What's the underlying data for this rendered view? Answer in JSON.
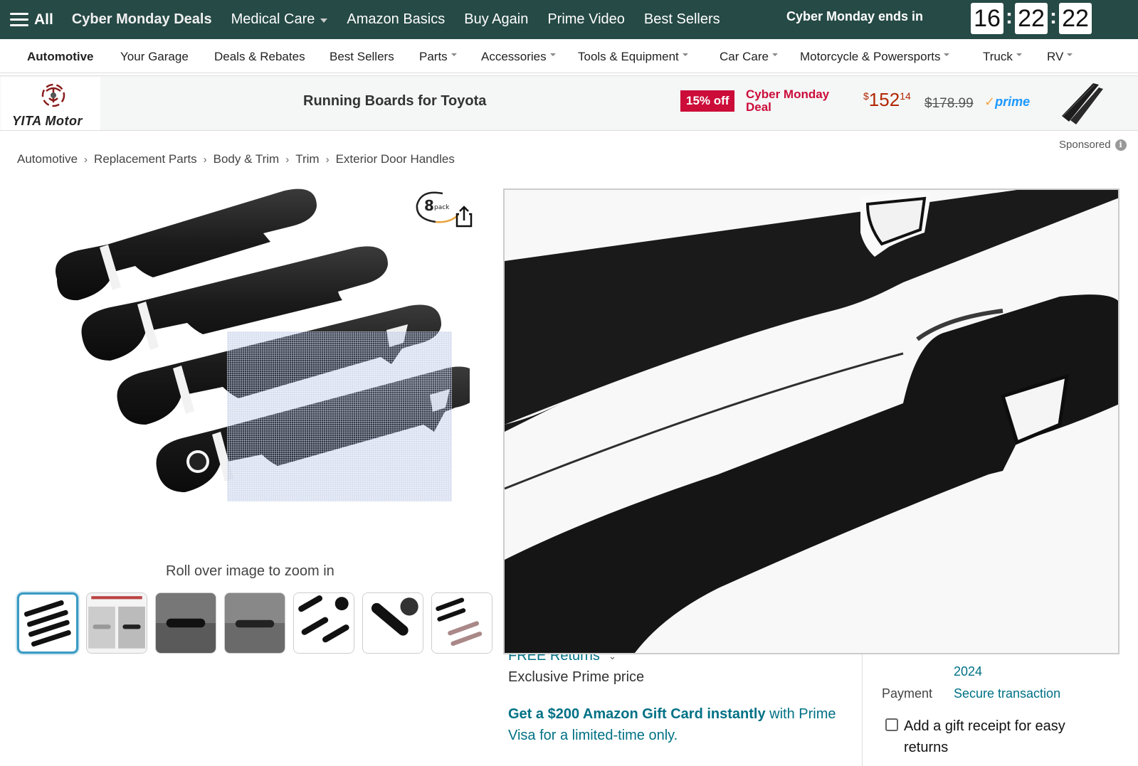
{
  "topnav": {
    "all_label": "All",
    "links": [
      {
        "label": "Cyber Monday Deals",
        "bold": true
      },
      {
        "label": "Medical Care",
        "dropdown": true
      },
      {
        "label": "Amazon Basics"
      },
      {
        "label": "Buy Again"
      },
      {
        "label": "Prime Video"
      },
      {
        "label": "Best Sellers"
      }
    ],
    "countdown_label": "Cyber Monday ends in",
    "countdown": {
      "hours": "16",
      "minutes": "22",
      "seconds": "22"
    }
  },
  "subnav": {
    "items": [
      {
        "label": "Automotive",
        "bold": true
      },
      {
        "label": "Your Garage"
      },
      {
        "label": "Deals & Rebates"
      },
      {
        "label": "Best Sellers"
      },
      {
        "label": "Parts",
        "dropdown": true
      },
      {
        "label": "Accessories",
        "dropdown": true
      },
      {
        "label": "Tools & Equipment",
        "dropdown": true
      },
      {
        "label": "Car Care",
        "dropdown": true
      },
      {
        "label": "Motorcycle & Powersports",
        "dropdown": true
      },
      {
        "label": "Truck",
        "dropdown": true
      },
      {
        "label": "RV",
        "dropdown": true
      }
    ]
  },
  "banner": {
    "logo_text": "YITA Motor",
    "title": "Running Boards for Toyota",
    "discount": "15% off",
    "deal_label": "Cyber Monday Deal",
    "price_symbol": "$",
    "price_whole": "152",
    "price_fraction": "14",
    "list_price": "$178.99",
    "prime_label": "prime",
    "sponsored_label": "Sponsored"
  },
  "breadcrumb": [
    "Automotive",
    "Replacement Parts",
    "Body & Trim",
    "Trim",
    "Exterior Door Handles"
  ],
  "gallery": {
    "pack_label": "8 pack",
    "rollover_text": "Roll over image to zoom in",
    "thumbnail_count": 7
  },
  "details": {
    "free_returns": "FREE Returns",
    "exclusive": "Exclusive Prime price",
    "giftcard_bold": "Get a $200 Amazon Gift Card instantly",
    "giftcard_rest": " with Prime Visa for a limited-time only."
  },
  "buybox": {
    "returns_text": "2024",
    "payment_label": "Payment",
    "payment_value": "Secure transaction",
    "gift_receipt_label": "Add a gift receipt for easy returns"
  },
  "colors": {
    "nav_bg": "#264a46",
    "deal_red": "#cc0c39",
    "link_teal": "#007185",
    "price_red": "#b12704",
    "thumb_active": "#3c9bc4"
  }
}
